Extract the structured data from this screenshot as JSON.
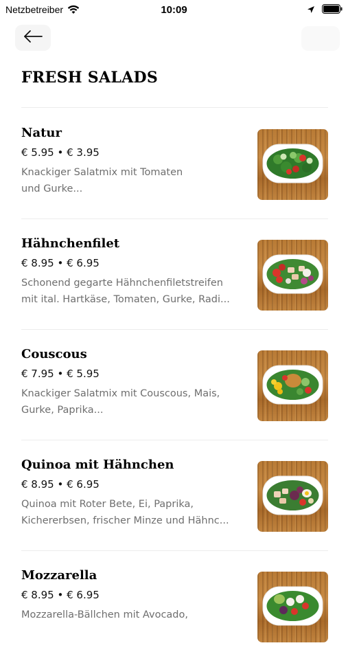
{
  "status_bar": {
    "carrier": "Netzbetreiber",
    "time": "10:09"
  },
  "page": {
    "title": "FRESH SALADS"
  },
  "items": [
    {
      "name": "Natur",
      "price": "€ 5.95 • € 3.95",
      "desc_line1": "Knackiger Salatmix mit Tomaten",
      "desc_line2": "und Gurke..."
    },
    {
      "name": "Hähnchenfilet",
      "price": "€ 8.95 • € 6.95",
      "desc_line1": "Schonend gegarte Hähnchenfiletstreifen",
      "desc_line2": "mit ital. Hartkäse, Tomaten, Gurke, Radi..."
    },
    {
      "name": "Couscous",
      "price": "€ 7.95 • € 5.95",
      "desc_line1": "Knackiger Salatmix mit Couscous, Mais,",
      "desc_line2": "Gurke, Paprika..."
    },
    {
      "name": "Quinoa mit Hähnchen",
      "price": "€ 8.95 • € 6.95",
      "desc_line1": "Quinoa mit Roter Bete, Ei, Paprika,",
      "desc_line2": "Kichererbsen, frischer Minze und Hähnc..."
    },
    {
      "name": "Mozzarella",
      "price": "€ 8.95 • € 6.95",
      "desc_line1": "Mozzarella-Bällchen mit Avocado,",
      "desc_line2": ""
    }
  ],
  "icons": {
    "back": "arrow-left-icon",
    "wifi": "wifi-icon",
    "location": "location-arrow-icon",
    "battery": "battery-icon"
  },
  "colors": {
    "text": "#111111",
    "secondary_text": "#6e6e6e",
    "divider": "#ececec",
    "wood": "#b87a35"
  }
}
